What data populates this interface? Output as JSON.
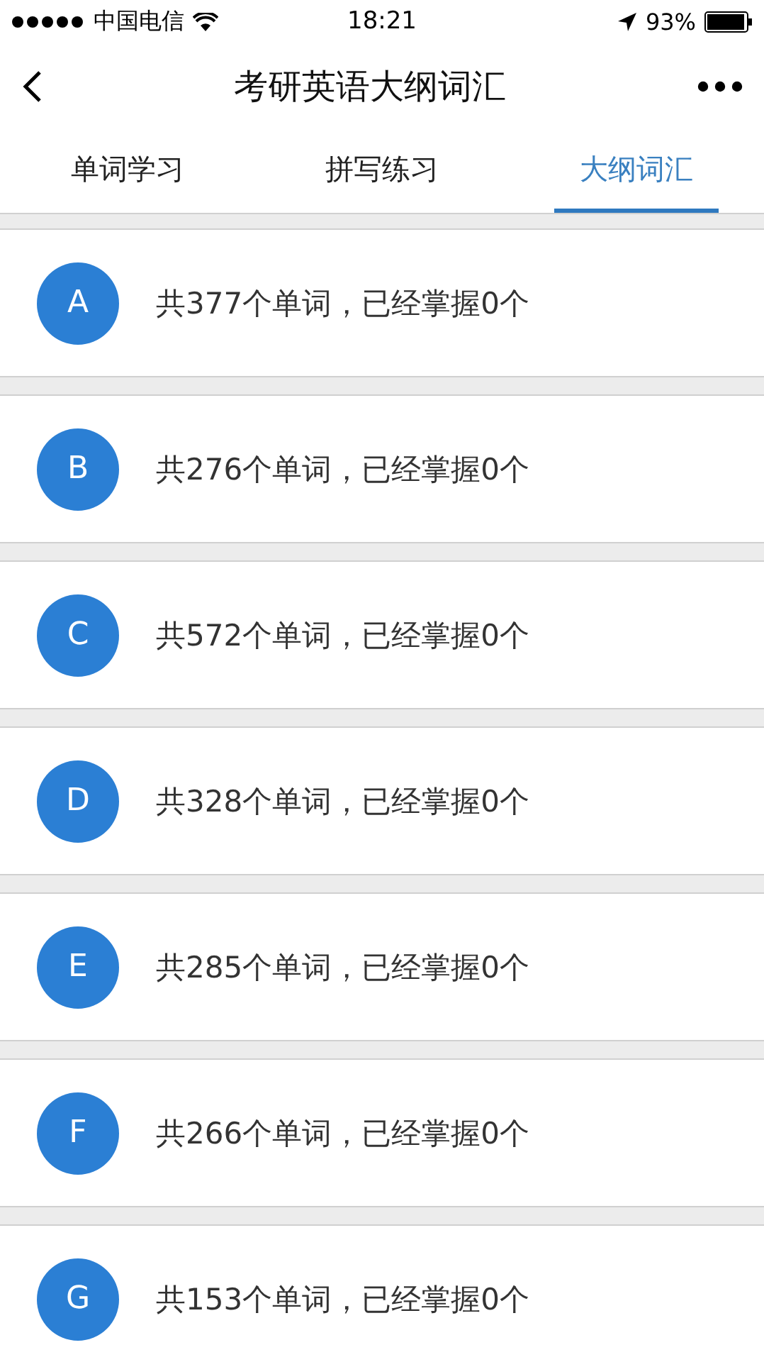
{
  "status_bar": {
    "carrier": "中国电信",
    "time": "18:21",
    "battery": "93%"
  },
  "nav": {
    "title": "考研英语大纲词汇"
  },
  "tabs": [
    {
      "label": "单词学习",
      "selected": false
    },
    {
      "label": "拼写练习",
      "selected": false
    },
    {
      "label": "大纲词汇",
      "selected": true
    }
  ],
  "groups": [
    {
      "letter": "A",
      "text": "共377个单词，已经掌握0个"
    },
    {
      "letter": "B",
      "text": "共276个单词，已经掌握0个"
    },
    {
      "letter": "C",
      "text": "共572个单词，已经掌握0个"
    },
    {
      "letter": "D",
      "text": "共328个单词，已经掌握0个"
    },
    {
      "letter": "E",
      "text": "共285个单词，已经掌握0个"
    },
    {
      "letter": "F",
      "text": "共266个单词，已经掌握0个"
    },
    {
      "letter": "G",
      "text": "共153个单词，已经掌握0个"
    }
  ]
}
